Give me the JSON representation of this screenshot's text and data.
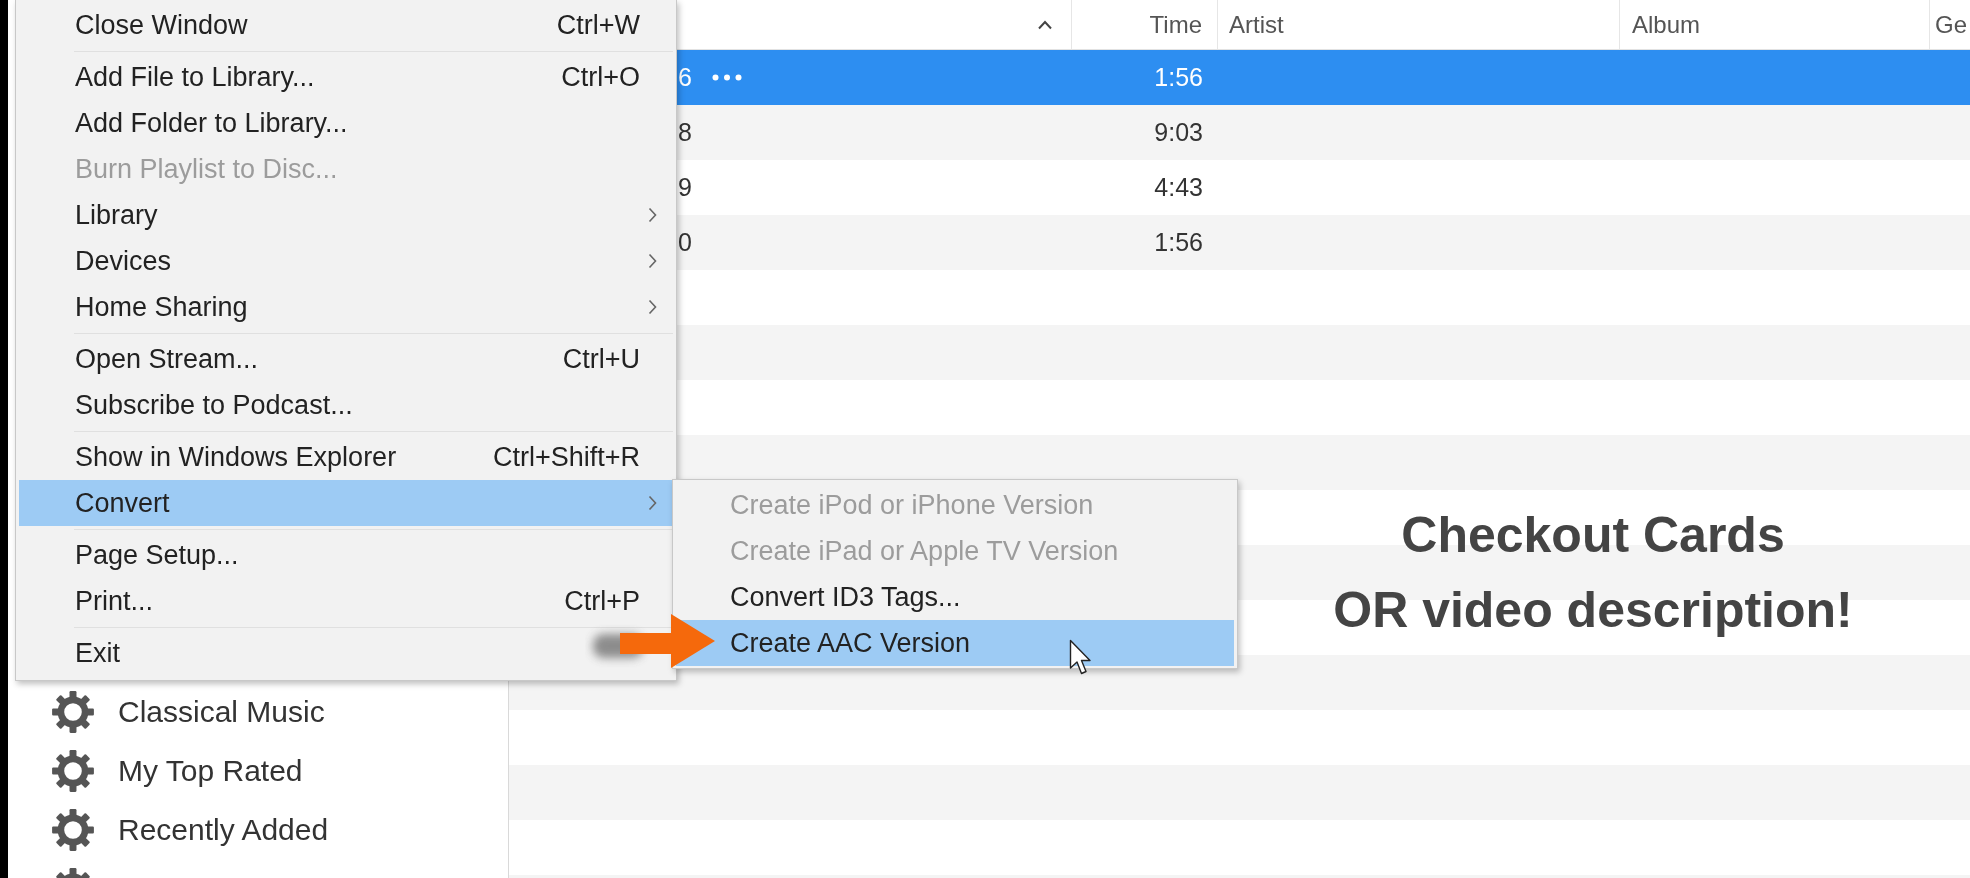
{
  "file_menu": {
    "items": [
      {
        "kind": "item",
        "label": "Close Window",
        "shortcut": "Ctrl+W",
        "has_submenu": false,
        "disabled": false,
        "selected": false
      },
      {
        "kind": "separator"
      },
      {
        "kind": "item",
        "label": "Add File to Library...",
        "shortcut": "Ctrl+O",
        "has_submenu": false,
        "disabled": false,
        "selected": false
      },
      {
        "kind": "item",
        "label": "Add Folder to Library...",
        "has_submenu": false,
        "disabled": false,
        "selected": false
      },
      {
        "kind": "item",
        "label": "Burn Playlist to Disc...",
        "has_submenu": false,
        "disabled": true,
        "selected": false
      },
      {
        "kind": "item",
        "label": "Library",
        "has_submenu": true,
        "disabled": false,
        "selected": false
      },
      {
        "kind": "item",
        "label": "Devices",
        "has_submenu": true,
        "disabled": false,
        "selected": false
      },
      {
        "kind": "item",
        "label": "Home Sharing",
        "has_submenu": true,
        "disabled": false,
        "selected": false
      },
      {
        "kind": "separator"
      },
      {
        "kind": "item",
        "label": "Open Stream...",
        "shortcut": "Ctrl+U",
        "has_submenu": false,
        "disabled": false,
        "selected": false
      },
      {
        "kind": "item",
        "label": "Subscribe to Podcast...",
        "has_submenu": false,
        "disabled": false,
        "selected": false
      },
      {
        "kind": "separator"
      },
      {
        "kind": "item",
        "label": "Show in Windows Explorer",
        "shortcut": "Ctrl+Shift+R",
        "has_submenu": false,
        "disabled": false,
        "selected": false
      },
      {
        "kind": "item",
        "label": "Convert",
        "has_submenu": true,
        "disabled": false,
        "selected": true
      },
      {
        "kind": "separator"
      },
      {
        "kind": "item",
        "label": "Page Setup...",
        "has_submenu": false,
        "disabled": false,
        "selected": false
      },
      {
        "kind": "item",
        "label": "Print...",
        "shortcut": "Ctrl+P",
        "has_submenu": false,
        "disabled": false,
        "selected": false
      },
      {
        "kind": "separator"
      },
      {
        "kind": "item",
        "label": "Exit",
        "has_submenu": false,
        "disabled": false,
        "selected": false
      }
    ]
  },
  "convert_submenu": {
    "items": [
      {
        "label": "Create iPod or iPhone Version",
        "disabled": true,
        "selected": false
      },
      {
        "label": "Create iPad or Apple TV Version",
        "disabled": true,
        "selected": false
      },
      {
        "label": "Convert ID3 Tags...",
        "disabled": false,
        "selected": false
      },
      {
        "label": "Create AAC Version",
        "disabled": false,
        "selected": true
      }
    ]
  },
  "sidebar": {
    "items": [
      {
        "kind": "playlist",
        "label": "Classical Music"
      },
      {
        "kind": "playlist",
        "label": "My Top Rated"
      },
      {
        "kind": "playlist",
        "label": "Recently Added"
      },
      {
        "kind": "cut_off"
      }
    ]
  },
  "table": {
    "columns": [
      {
        "sorted": true
      },
      {
        "label": "Time"
      },
      {
        "label": "Artist"
      },
      {
        "label": "Album"
      },
      {
        "label": "Ge"
      }
    ],
    "rows": [
      {
        "name": "6",
        "time": "1:56",
        "selected": true
      },
      {
        "name": "8",
        "time": "9:03",
        "selected": false
      },
      {
        "name": "9",
        "time": "4:43",
        "selected": false
      },
      {
        "name": "0",
        "time": "1:56",
        "selected": false
      }
    ]
  },
  "annotation": {
    "lines": [
      "Checkout Cards",
      "OR video description!"
    ]
  }
}
